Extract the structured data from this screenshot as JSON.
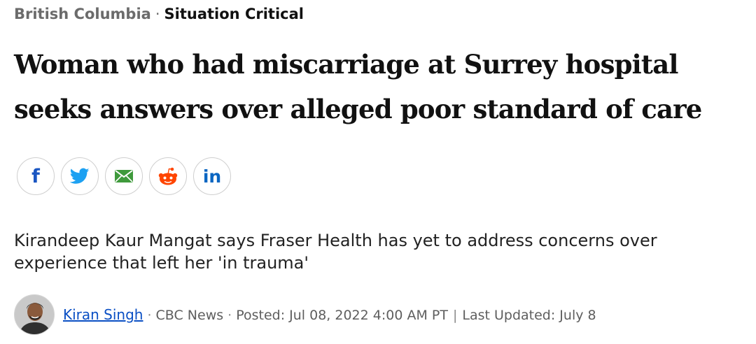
{
  "breadcrumb": {
    "section": "British Columbia",
    "separator": "·",
    "topic": "Situation Critical"
  },
  "headline": "Woman who had miscarriage at Surrey hospital seeks answers over alleged poor standard of care",
  "share": {
    "facebook_glyph": "f",
    "linkedin_glyph": "in",
    "icons": [
      "facebook-icon",
      "twitter-icon",
      "email-icon",
      "reddit-icon",
      "linkedin-icon"
    ],
    "colors": {
      "facebook": "#1a56c2",
      "twitter": "#1da1f2",
      "email": "#3f9a3c",
      "reddit": "#ff4500",
      "linkedin": "#0a66c2"
    }
  },
  "deck": "Kirandeep Kaur Mangat says Fraser Health has yet to address concerns over experience that left her 'in trauma'",
  "byline": {
    "author": "Kiran Singh",
    "dot": "·",
    "outlet": "CBC News",
    "posted": "Posted: Jul 08, 2022 4:00 AM PT",
    "pipe": "|",
    "updated": "Last Updated: July 8"
  },
  "colors": {
    "link": "#0a4fc4",
    "muted_text": "#6b6b6b",
    "border": "#cfcfcf"
  }
}
